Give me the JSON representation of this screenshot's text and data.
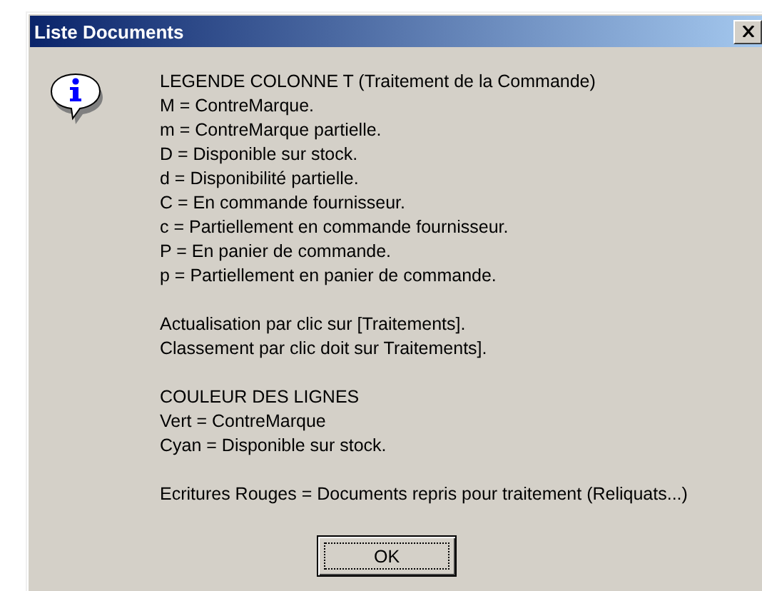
{
  "window": {
    "title": "Liste Documents"
  },
  "message": {
    "paragraphs": [
      [
        "LEGENDE COLONNE T (Traitement de la Commande)",
        "M = ContreMarque.",
        "m = ContreMarque partielle.",
        "D = Disponible sur stock.",
        "d = Disponibilité partielle.",
        "C = En commande fournisseur.",
        "c = Partiellement en commande fournisseur.",
        "P = En panier de commande.",
        "p = Partiellement en panier de commande."
      ],
      [
        "Actualisation par clic sur [Traitements].",
        "Classement par clic doit sur Traitements]."
      ],
      [
        "COULEUR DES LIGNES",
        "Vert = ContreMarque",
        "Cyan = Disponible sur stock."
      ],
      [
        "Ecritures Rouges = Documents repris pour traitement (Reliquats...)"
      ]
    ]
  },
  "buttons": [
    {
      "label": "OK"
    }
  ]
}
